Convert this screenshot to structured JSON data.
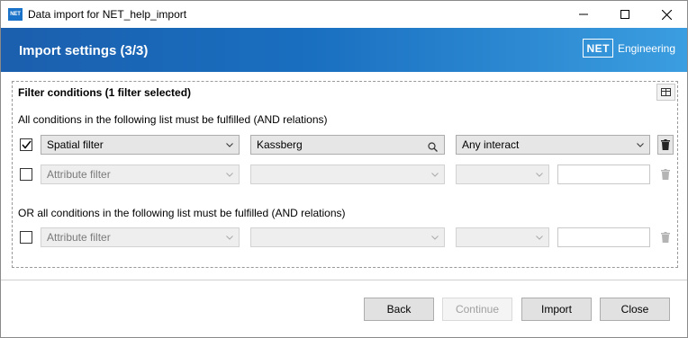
{
  "window": {
    "app_icon_text": "NET",
    "title": "Data import for NET_help_import"
  },
  "banner": {
    "title": "Import settings (3/3)",
    "brand_box": "NET",
    "brand_text": "Engineering",
    "gradient_start": "#1b5fae",
    "gradient_end": "#3b9ee0"
  },
  "filter_group": {
    "title": "Filter conditions (1 filter selected)",
    "and_label": "All conditions in the following list must be fulfilled (AND relations)",
    "or_label": "OR all conditions in the following list must be fulfilled (AND relations)",
    "and_rows": [
      {
        "checked": true,
        "type": "Spatial filter",
        "value": "Kassberg",
        "operator": "Any interact",
        "enabled": true
      },
      {
        "checked": false,
        "type": "Attribute filter",
        "value": "",
        "operator": "",
        "enabled": false
      }
    ],
    "or_rows": [
      {
        "checked": false,
        "type": "Attribute filter",
        "value": "",
        "operator": "",
        "enabled": false
      }
    ]
  },
  "footer": {
    "back": "Back",
    "continue": "Continue",
    "import": "Import",
    "close": "Close"
  }
}
